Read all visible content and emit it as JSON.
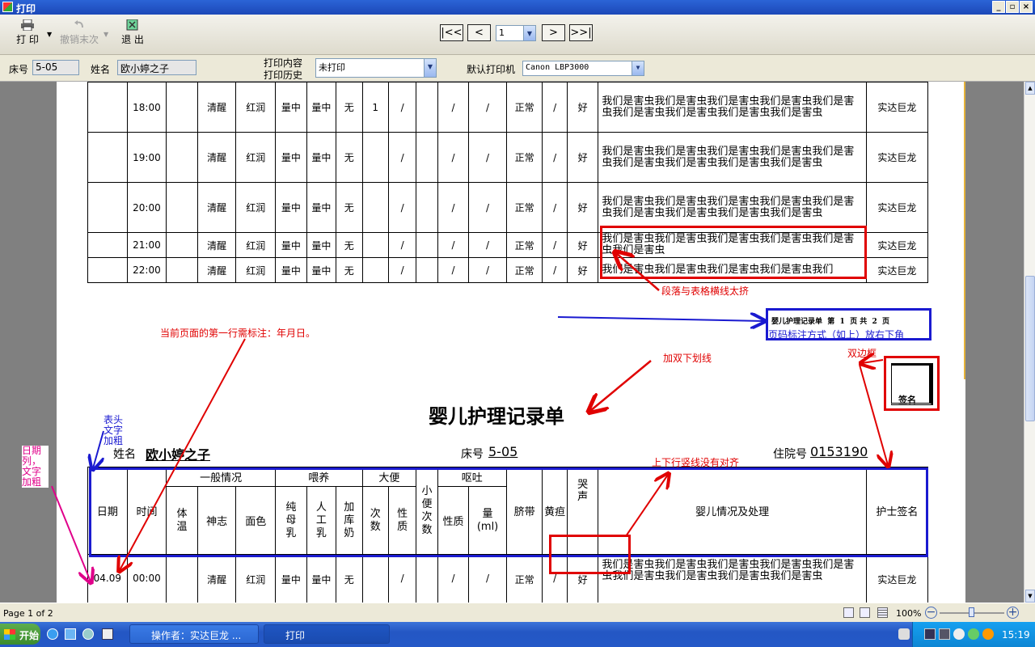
{
  "window": {
    "title": "打印"
  },
  "toolbar": {
    "print": "打 印",
    "undo": "撤销末次",
    "exit": "退 出",
    "first": "|<<",
    "prev": "<",
    "page_value": "1",
    "next": ">",
    "last": ">>|"
  },
  "filter": {
    "bed_label": "床号",
    "bed_value": "5-05",
    "name_label": "姓名",
    "name_value": "欧小婷之子",
    "print_content_label": "打印内容",
    "print_history_label": "打印历史",
    "print_content_value": "未打印",
    "default_printer_label": "默认打印机",
    "printer_value": "Canon LBP3000"
  },
  "page1": {
    "rows": [
      {
        "time": "18:00",
        "mind": "清醒",
        "color": "红润",
        "m1": "量中",
        "m2": "量中",
        "m3": "无",
        "stool": "1",
        "nature": "/",
        "vt": "/",
        "vq": "/",
        "cord": "正常",
        "jaundice": "/",
        "cry": "好",
        "remark": "我们是害虫我们是害虫我们是害虫我们是害虫我们是害虫我们是害虫我们是害虫我们是害虫我们是害虫",
        "nurse": "实达巨龙"
      },
      {
        "time": "19:00",
        "mind": "清醒",
        "color": "红润",
        "m1": "量中",
        "m2": "量中",
        "m3": "无",
        "stool": "",
        "nature": "/",
        "vt": "/",
        "vq": "/",
        "cord": "正常",
        "jaundice": "/",
        "cry": "好",
        "remark": "我们是害虫我们是害虫我们是害虫我们是害虫我们是害虫我们是害虫我们是害虫我们是害虫我们是害虫",
        "nurse": "实达巨龙"
      },
      {
        "time": "20:00",
        "mind": "清醒",
        "color": "红润",
        "m1": "量中",
        "m2": "量中",
        "m3": "无",
        "stool": "",
        "nature": "/",
        "vt": "/",
        "vq": "/",
        "cord": "正常",
        "jaundice": "/",
        "cry": "好",
        "remark": "我们是害虫我们是害虫我们是害虫我们是害虫我们是害虫我们是害虫我们是害虫我们是害虫我们是害虫",
        "nurse": "实达巨龙"
      },
      {
        "time": "21:00",
        "mind": "清醒",
        "color": "红润",
        "m1": "量中",
        "m2": "量中",
        "m3": "无",
        "stool": "",
        "nature": "/",
        "vt": "/",
        "vq": "/",
        "cord": "正常",
        "jaundice": "/",
        "cry": "好",
        "remark": "我们是害虫我们是害虫我们是害虫我们是害虫我们是害虫我们是害虫",
        "nurse": "实达巨龙"
      },
      {
        "time": "22:00",
        "mind": "清醒",
        "color": "红润",
        "m1": "量中",
        "m2": "量中",
        "m3": "无",
        "stool": "",
        "nature": "/",
        "vt": "/",
        "vq": "/",
        "cord": "正常",
        "jaundice": "/",
        "cry": "好",
        "remark": "我们是害虫我们是害虫我们是害虫我们是害虫我们",
        "nurse": "实达巨龙"
      }
    ],
    "page_label_1": "第",
    "page_num": "1",
    "page_label_2": "页"
  },
  "annotations": {
    "a1": "段落与表格横线太挤",
    "a2": "婴儿护理记录单  第  1  页 共  2  页",
    "a3": "页码标注方式（如上）放右下角",
    "a4": "当前页面的第一行需标注：年月日。",
    "a5": "加双下划线",
    "a6": "双边框",
    "a7": "签名",
    "a8": "表头文字加粗",
    "a9": "日期列，文字加粗",
    "a10": "上下行竖线没有对齐"
  },
  "page2": {
    "title": "婴儿护理记录单",
    "name_label": "姓名",
    "name_value": "欧小婷之子",
    "bed_label": "床号",
    "bed_value": "5-05",
    "admit_label": "住院号",
    "admit_value": "0153190",
    "headers": {
      "date": "日期",
      "time": "时间",
      "general": "一般情况",
      "temp": "体温",
      "mind": "神志",
      "color": "面色",
      "feed": "喂养",
      "breast": "纯母乳",
      "artificial": "人工乳",
      "formula": "加库奶",
      "stool": "大便",
      "stool_n": "次数",
      "stool_nature": "性质",
      "urine": "小便次数",
      "vomit": "呕吐",
      "vomit_nature": "性质",
      "vomit_amount": "量(ml)",
      "cord": "脐带",
      "jaundice": "黄疸",
      "cry": "哭声",
      "situation": "婴儿情况及处理",
      "nurse": "护士签名"
    },
    "row": {
      "date": "04.09",
      "time": "00:00",
      "mind": "清醒",
      "color": "红润",
      "m1": "量中",
      "m2": "量中",
      "m3": "无",
      "nature": "/",
      "vt": "/",
      "vq": "/",
      "cord": "正常",
      "jaundice": "/",
      "cry": "好",
      "remark": "我们是害虫我们是害虫我们是害虫我们是害虫我们是害虫我们是害虫我们是害虫我们是害虫我们是害虫",
      "nurse": "实达巨龙"
    }
  },
  "status": {
    "page_text": "Page 1 of 2",
    "zoom": "100%"
  },
  "taskbar": {
    "start": "开始",
    "task1": "操作者：实达巨龙 ...",
    "task2": "打印",
    "clock": "15:19"
  }
}
